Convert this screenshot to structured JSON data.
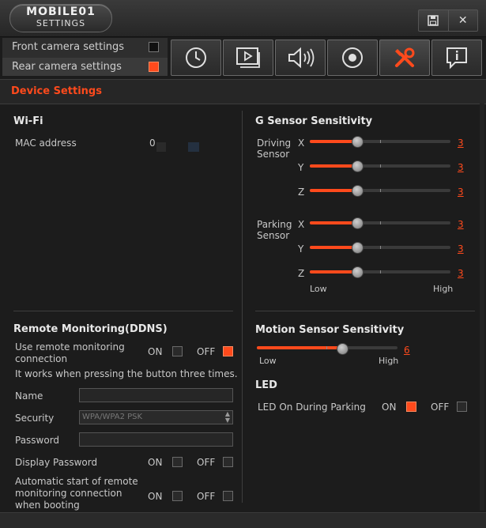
{
  "logo": {
    "brand": "MOBILE01",
    "sub": "SETTINGS"
  },
  "window": {
    "save_icon": "save-icon",
    "close_label": "✕"
  },
  "cameras": [
    {
      "label": "Front camera settings",
      "active": false
    },
    {
      "label": "Rear camera settings",
      "active": true
    }
  ],
  "toolbar": {
    "items": [
      "clock-icon",
      "video-icon",
      "speaker-icon",
      "record-icon",
      "tools-icon",
      "info-icon"
    ],
    "active_index": 4
  },
  "section_title": "Device Settings",
  "wifi": {
    "title": "Wi-Fi",
    "mac_label": "MAC address",
    "mac_value": "0"
  },
  "gsensor": {
    "title": "G Sensor Sensitivity",
    "driving_label": "Driving\nSensor",
    "parking_label": "Parking\nSensor",
    "axes": [
      "X",
      "Y",
      "Z"
    ],
    "driving_values": [
      3,
      3,
      3
    ],
    "parking_values": [
      3,
      3,
      3
    ],
    "max": 5,
    "low": "Low",
    "high": "High"
  },
  "motion": {
    "title": "Motion Sensor Sensitivity",
    "value": 6,
    "max": 10,
    "low": "Low",
    "high": "High"
  },
  "led": {
    "title": "LED",
    "label": "LED On During Parking",
    "on": "ON",
    "off": "OFF",
    "state": "on"
  },
  "ddns": {
    "title": "Remote Monitoring(DDNS)",
    "use_label": "Use remote monitoring connection",
    "use_state": "off",
    "hint": "It works when pressing the button three times.",
    "name_label": "Name",
    "name_value": "",
    "security_label": "Security",
    "security_value": "WPA/WPA2 PSK",
    "password_label": "Password",
    "password_value": "",
    "display_password_label": "Display Password",
    "auto_label": "Automatic start of remote monitoring connection when booting",
    "on": "ON",
    "off": "OFF"
  },
  "colors": {
    "accent": "#ff4a1c"
  }
}
